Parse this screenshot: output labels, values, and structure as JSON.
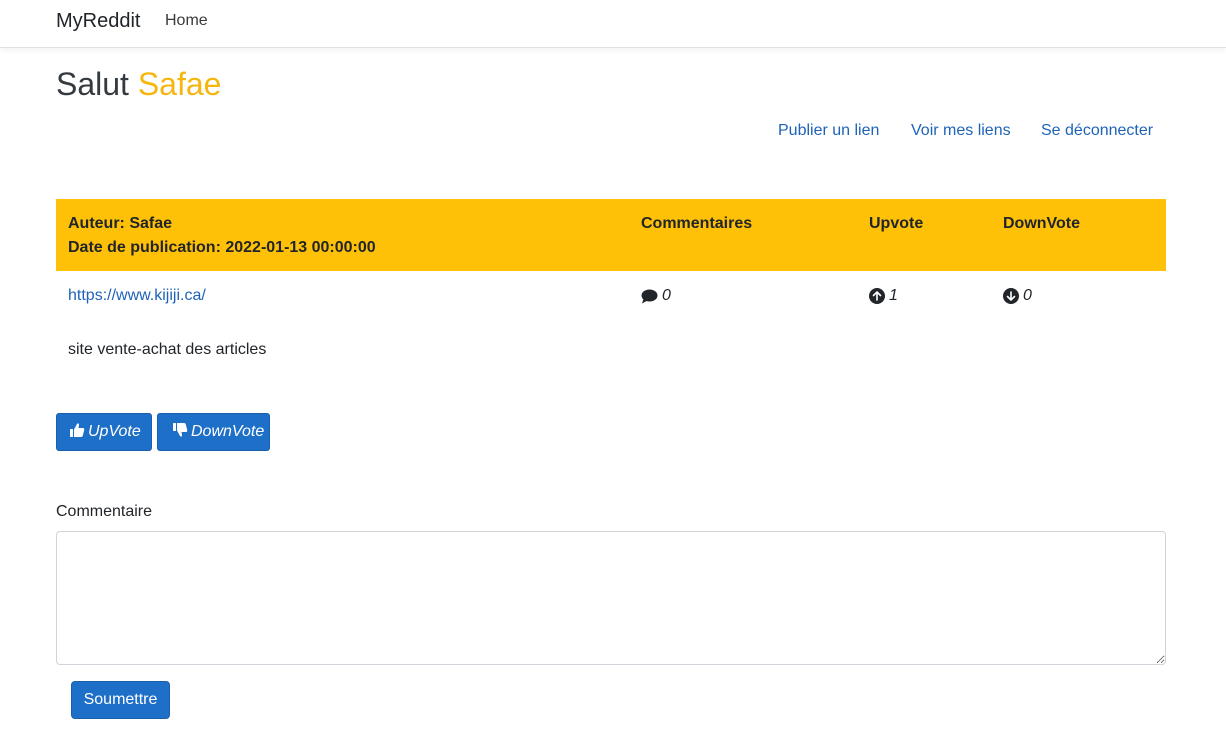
{
  "navbar": {
    "brand": "MyReddit",
    "home": "Home"
  },
  "greeting": {
    "prefix": "Salut",
    "name": "Safae"
  },
  "actions": {
    "publish": "Publier un lien",
    "my_links": "Voir mes liens",
    "logout": "Se déconnecter"
  },
  "post": {
    "author_line": "Auteur: Safae",
    "date_line": "Date de publication: 2022-01-13 00:00:00",
    "col_comments": "Commentaires",
    "col_upvote": "Upvote",
    "col_downvote": "DownVote",
    "link": "https://www.kijiji.ca/",
    "comments_count": "0",
    "upvote_count": "1",
    "downvote_count": "0",
    "description": "site vente-achat des articles"
  },
  "buttons": {
    "upvote": "UpVote",
    "downvote": "DownVote"
  },
  "comment_form": {
    "label": "Commentaire",
    "value": "",
    "submit": "Soumettre"
  },
  "icons": {
    "comment": "comment-icon",
    "arrow_up": "arrow-up-circle-icon",
    "arrow_down": "arrow-down-circle-icon",
    "thumbs_up": "thumbs-up-icon",
    "thumbs_down": "thumbs-down-icon"
  },
  "colors": {
    "accent": "#ffc107",
    "greeting_name": "#f5b70f",
    "link": "#1e63b8",
    "button": "#1e6fc7"
  }
}
